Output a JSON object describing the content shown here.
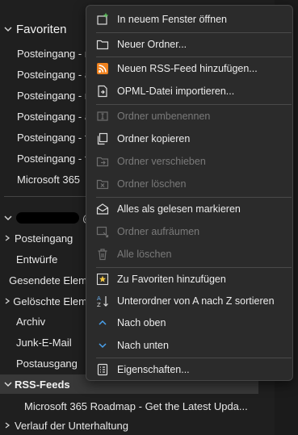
{
  "favorites": {
    "header": "Favoriten",
    "items": [
      "Posteingang - r",
      "Posteingang - a",
      "Posteingang - n",
      "Posteingang - a",
      "Posteingang - f",
      "Posteingang - f",
      "Microsoft 365"
    ]
  },
  "account": {
    "suffix": "@"
  },
  "folders": [
    {
      "label": "Posteingang",
      "expandable": true
    },
    {
      "label": "Entwürfe",
      "expandable": false
    },
    {
      "label": "Gesendete Elem",
      "expandable": false
    },
    {
      "label": "Gelöschte Elem",
      "expandable": true
    },
    {
      "label": "Archiv",
      "expandable": false
    },
    {
      "label": "Junk-E-Mail",
      "expandable": false
    },
    {
      "label": "Postausgang",
      "expandable": false
    }
  ],
  "rss": {
    "label": "RSS-Feeds",
    "sub_item": "Microsoft 365 Roadmap - Get the Latest Upda..."
  },
  "history": {
    "label": "Verlauf der Unterhaltung"
  },
  "menu": {
    "items": [
      {
        "label": "In neuem Fenster öffnen",
        "icon": "new-window-icon",
        "enabled": true
      },
      {
        "label": "Neuer Ordner...",
        "icon": "folder-icon",
        "enabled": true
      },
      {
        "label": "Neuen RSS-Feed hinzufügen...",
        "icon": "rss-icon",
        "enabled": true
      },
      {
        "label": "OPML-Datei importieren...",
        "icon": "import-file-icon",
        "enabled": true
      },
      {
        "label": "Ordner umbenennen",
        "icon": "rename-icon",
        "enabled": false
      },
      {
        "label": "Ordner kopieren",
        "icon": "copy-folder-icon",
        "enabled": true
      },
      {
        "label": "Ordner verschieben",
        "icon": "move-folder-icon",
        "enabled": false
      },
      {
        "label": "Ordner löschen",
        "icon": "delete-folder-icon",
        "enabled": false
      },
      {
        "label": "Alles als gelesen markieren",
        "icon": "mark-read-icon",
        "enabled": true
      },
      {
        "label": "Ordner aufräumen",
        "icon": "cleanup-icon",
        "enabled": false
      },
      {
        "label": "Alle löschen",
        "icon": "delete-all-icon",
        "enabled": false
      },
      {
        "label": "Zu Favoriten hinzufügen",
        "icon": "star-icon",
        "enabled": true
      },
      {
        "label": "Unterordner von A nach Z sortieren",
        "icon": "sort-az-icon",
        "enabled": true
      },
      {
        "label": "Nach oben",
        "icon": "chevron-up-icon",
        "enabled": true
      },
      {
        "label": "Nach unten",
        "icon": "chevron-down-icon",
        "enabled": true
      },
      {
        "label": "Eigenschaften...",
        "icon": "properties-icon",
        "enabled": true
      }
    ]
  },
  "colors": {
    "background": "#1f1f1f",
    "menu_background": "#2b2b2b",
    "selected_row": "#383838",
    "rss_orange": "#f0821e",
    "accent_blue": "#4aa3f0",
    "disabled_text": "#7a7a7a"
  }
}
